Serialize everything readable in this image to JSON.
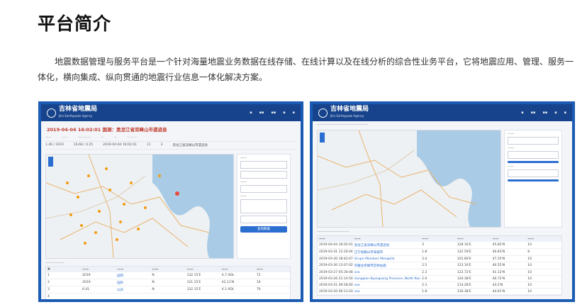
{
  "page": {
    "title": "平台简介",
    "intro": "地震数据管理与服务平台是一个针对海量地震业务数据在线存储、在线计算以及在线分析的综合性业务平台，它将地震应用、管理、服务一体化，横向集成、纵向贯通的地震行业信息一体化解决方案。"
  },
  "left_shot": {
    "logo_cn": "吉林省地震局",
    "logo_en": "Jilin Earthquake Agency",
    "event_title": "2019-04-04 16:02:01 国测：黑龙江省双峰山市遗迹县",
    "event_row": [
      "1.46 / 2019",
      "16.68 / 4.25",
      "2019-04-04 16:02:01",
      "11",
      "3",
      "黑龙江省双峰山市遗迹县"
    ],
    "table_rows": [
      [
        "1",
        "2019",
        "国内",
        "N",
        "132 15'E",
        "4.7 ADL",
        "72"
      ],
      [
        "2",
        "2019",
        "国外",
        "N",
        "121 15'E",
        "42.11'N",
        "16"
      ],
      [
        "3",
        "6.41",
        "山东",
        "N",
        "132 15'E",
        "4.1 ADL",
        "70"
      ],
      [
        "4",
        "",
        "",
        "",
        "",
        "",
        ""
      ]
    ],
    "button": "查询数据"
  },
  "right_shot": {
    "logo_cn": "吉林省地震局",
    "logo_en": "Jilin Earthquake Agency",
    "table_rows": [
      [
        "2019-04-04 16:02:01",
        "黑龙江省双峰山市遗迹县",
        "3",
        "128 16'E",
        "45.82'N",
        "10"
      ],
      [
        "2019-03-31 11:26:04",
        "辽宁省鞍山市海城市",
        "1.8",
        "122 59'E",
        "40.83'N",
        "8"
      ],
      [
        "2019-03-30 18:42:07",
        "Grupo Mondaer Mongolia",
        "3.4",
        "101.66'E",
        "47.35'N",
        "10"
      ],
      [
        "2019-03-30 13:07:02",
        "内蒙古赤峰市巴林右旗",
        "2.5",
        "123.16'E",
        "40.55'N",
        "10"
      ],
      [
        "2019-03-27 05:30:48",
        "xxx",
        "2.3",
        "122.72'E",
        "41.12'N",
        "10"
      ],
      [
        "2019-03-26 21:14:50",
        "Gangwon-Kyongsang Province, North Korea",
        "2.9",
        "126.38'E",
        "40.72'N",
        "10"
      ],
      [
        "2019-03-21 09:28:00",
        "xxx",
        "2.3",
        "114.28'E",
        "43.5'N",
        "10"
      ],
      [
        "2019-03-20 06:11:03",
        "xxx",
        "1.8",
        "126.38'E",
        "44.61'N",
        "10"
      ]
    ]
  }
}
